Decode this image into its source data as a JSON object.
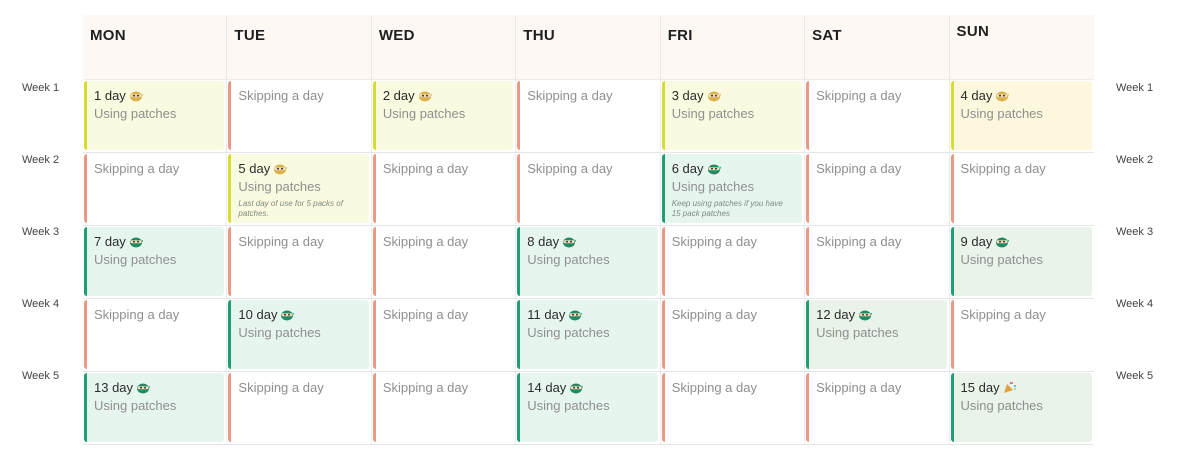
{
  "days": [
    "MON",
    "TUE",
    "WED",
    "THU",
    "FRI",
    "SAT",
    "SUN"
  ],
  "weeks": [
    "Week 1",
    "Week 2",
    "Week 3",
    "Week 4",
    "Week 5"
  ],
  "rows": [
    [
      {
        "kind": "yellow",
        "title": "1 day",
        "sub": "Using patches",
        "icon": "ninja-yellow-icon"
      },
      {
        "kind": "skip",
        "text": "Skipping a day"
      },
      {
        "kind": "yellow",
        "title": "2 day",
        "sub": "Using patches",
        "icon": "ninja-yellow-icon"
      },
      {
        "kind": "skip",
        "text": "Skipping a day"
      },
      {
        "kind": "yellow",
        "title": "3 day",
        "sub": "Using patches",
        "icon": "ninja-yellow-icon"
      },
      {
        "kind": "skip",
        "text": "Skipping a day"
      },
      {
        "kind": "yellow2",
        "title": "4 day",
        "sub": "Using patches",
        "icon": "ninja-yellow-icon"
      }
    ],
    [
      {
        "kind": "skip",
        "text": "Skipping a day"
      },
      {
        "kind": "yellow",
        "title": "5 day",
        "sub": "Using patches",
        "icon": "ninja-yellow-icon",
        "note": "Last day of use for 5 packs of patches."
      },
      {
        "kind": "skip",
        "text": "Skipping a day"
      },
      {
        "kind": "skip",
        "text": "Skipping a day"
      },
      {
        "kind": "mint",
        "title": "6 day",
        "sub": "Using patches",
        "icon": "ninja-green-icon",
        "note": "Keep using patches if you have 15 pack patches"
      },
      {
        "kind": "skip",
        "text": "Skipping a day"
      },
      {
        "kind": "skip",
        "text": "Skipping a day"
      }
    ],
    [
      {
        "kind": "mint",
        "title": "7 day",
        "sub": "Using patches",
        "icon": "ninja-green-icon"
      },
      {
        "kind": "skip",
        "text": "Skipping a day"
      },
      {
        "kind": "skip",
        "text": "Skipping a day"
      },
      {
        "kind": "mint",
        "title": "8 day",
        "sub": "Using patches",
        "icon": "ninja-green-icon"
      },
      {
        "kind": "skip",
        "text": "Skipping a day"
      },
      {
        "kind": "skip",
        "text": "Skipping a day"
      },
      {
        "kind": "sage",
        "title": "9 day",
        "sub": "Using patches",
        "icon": "ninja-green-icon"
      }
    ],
    [
      {
        "kind": "skip",
        "text": "Skipping a day"
      },
      {
        "kind": "mint",
        "title": "10 day",
        "sub": "Using patches",
        "icon": "ninja-green-icon"
      },
      {
        "kind": "skip",
        "text": "Skipping a day"
      },
      {
        "kind": "mint",
        "title": "11 day",
        "sub": "Using patches",
        "icon": "ninja-green-icon"
      },
      {
        "kind": "skip",
        "text": "Skipping a day"
      },
      {
        "kind": "sage",
        "title": "12 day",
        "sub": "Using patches",
        "icon": "ninja-green-icon"
      },
      {
        "kind": "skip",
        "text": "Skipping a day"
      }
    ],
    [
      {
        "kind": "mint",
        "title": "13 day",
        "sub": "Using patches",
        "icon": "ninja-green-icon"
      },
      {
        "kind": "skip",
        "text": "Skipping a day"
      },
      {
        "kind": "skip",
        "text": "Skipping a day"
      },
      {
        "kind": "mint",
        "title": "14 day",
        "sub": "Using patches",
        "icon": "ninja-green-icon"
      },
      {
        "kind": "skip",
        "text": "Skipping a day"
      },
      {
        "kind": "skip",
        "text": "Skipping a day"
      },
      {
        "kind": "sage",
        "title": "15 day",
        "sub": "Using patches",
        "icon": "party-popper-icon"
      }
    ]
  ],
  "colors": {
    "skip_bar": "#ea9a84",
    "yellow_bar": "#d6dc35",
    "green_bar": "#1f9d73",
    "yellow_bg": "#fafae0",
    "mint_bg": "#e6f6ef",
    "sage_bg": "#e9f3ea",
    "header_bg": "#fdf8f4"
  }
}
